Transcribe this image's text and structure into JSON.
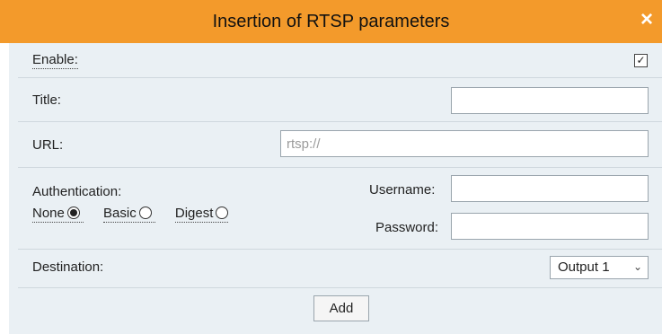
{
  "dialog": {
    "title": "Insertion of RTSP parameters",
    "close_symbol": "×"
  },
  "form": {
    "enable": {
      "label": "Enable:",
      "checked": true,
      "check_mark": "✓"
    },
    "title": {
      "label": "Title:",
      "value": ""
    },
    "url": {
      "label": "URL:",
      "placeholder": "rtsp://"
    },
    "authentication": {
      "label": "Authentication:",
      "options": [
        {
          "label": "None",
          "selected": true
        },
        {
          "label": "Basic",
          "selected": false
        },
        {
          "label": "Digest",
          "selected": false
        }
      ],
      "username_label": "Username:",
      "password_label": "Password:"
    },
    "destination": {
      "label": "Destination:",
      "selected": "Output 1"
    },
    "add_label": "Add"
  },
  "colors": {
    "titlebar": "#f39a2b",
    "panel": "#eaf0f4"
  },
  "icons": {
    "close": "close-icon",
    "chevron": "chevron-down-icon"
  }
}
